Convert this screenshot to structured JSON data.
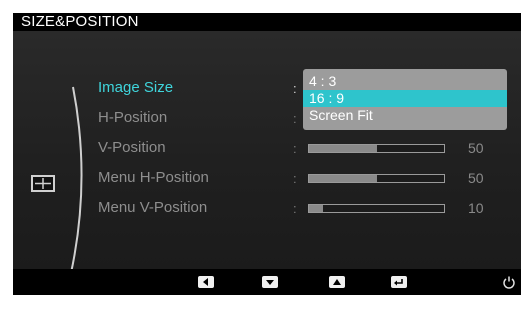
{
  "title": "SIZE&POSITION",
  "menu_items": [
    {
      "label": "Image Size",
      "active": true
    },
    {
      "label": "H-Position",
      "active": false
    },
    {
      "label": "V-Position",
      "active": false
    },
    {
      "label": "Menu H-Position",
      "active": false
    },
    {
      "label": "Menu V-Position",
      "active": false
    }
  ],
  "separator": ":",
  "dropdown_options": [
    {
      "label": "4 : 3",
      "selected": false
    },
    {
      "label": "16 : 9",
      "selected": true
    },
    {
      "label": "Screen Fit",
      "selected": false
    }
  ],
  "sliders": {
    "v_position": {
      "value": "50",
      "level_percent": 50
    },
    "menu_h_position": {
      "value": "50",
      "level_percent": 50
    },
    "menu_v_position": {
      "value": "10",
      "level_percent": 10
    }
  },
  "nav_icons": [
    "left-arrow-icon",
    "down-arrow-icon",
    "up-arrow-icon",
    "enter-icon",
    "power-icon"
  ],
  "colors": {
    "accent": "#3fd5dc",
    "selected_bg": "#2ec4cc",
    "dropdown_bg": "#9c9c9c",
    "text_dim": "#8e8e8e"
  }
}
